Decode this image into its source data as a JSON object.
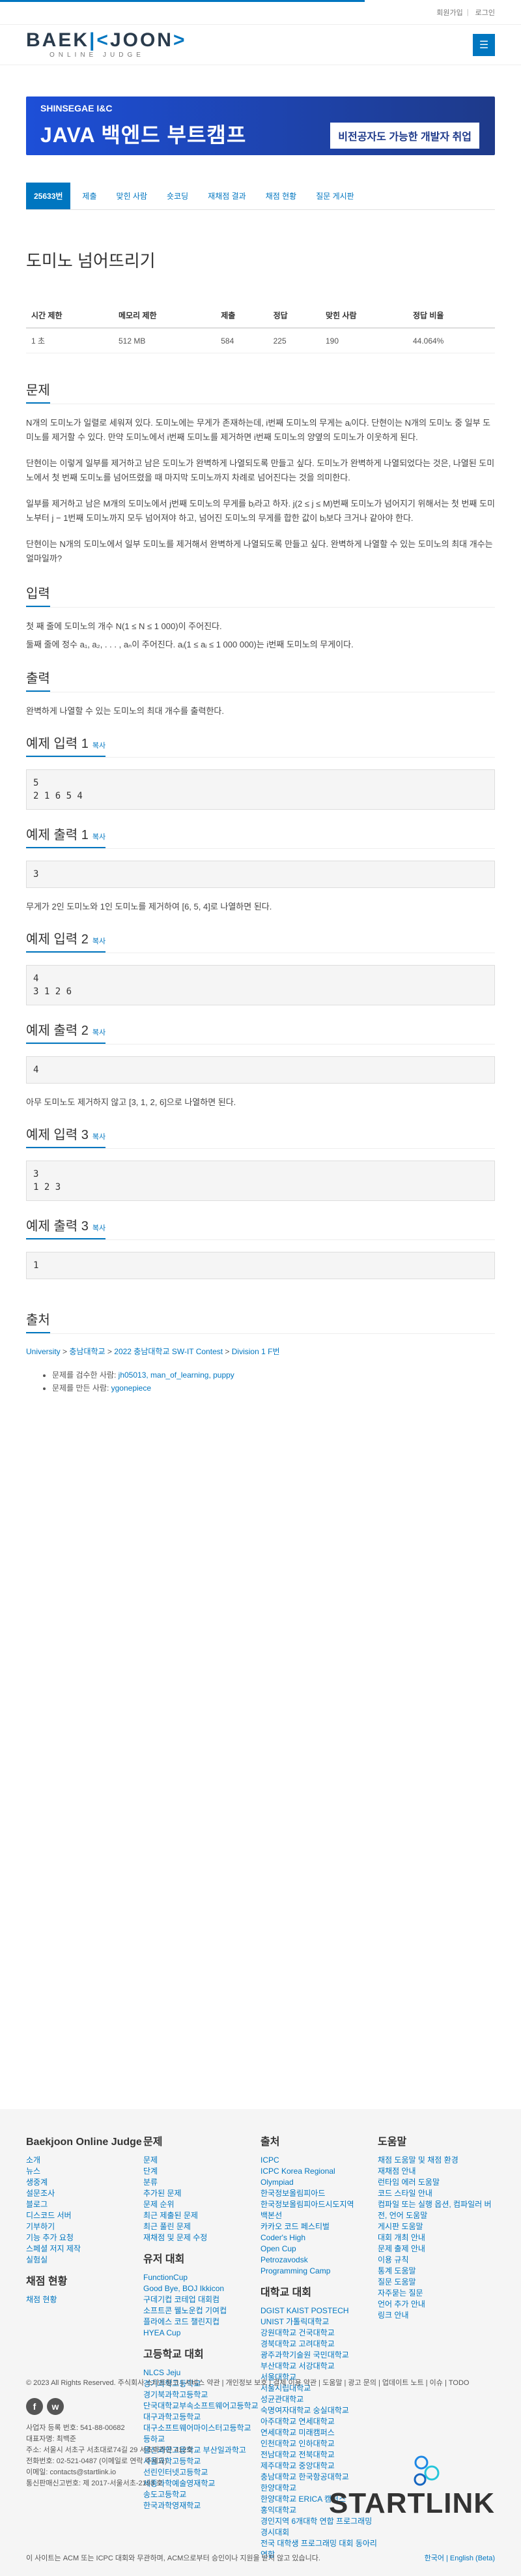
{
  "topbar": {
    "signup": "회원가입",
    "login": "로그인"
  },
  "logo": {
    "main_part1": "BAEK",
    "main_part2": "JOON",
    "sub": "ONLINE JUDGE"
  },
  "ad": {
    "top": "SHINSEGAE I&C",
    "left": "JAVA 백엔드 부트캠프",
    "right": "비전공자도 가능한 개발자 취업"
  },
  "tabs": [
    "25633번",
    "제출",
    "맞힌 사람",
    "숏코딩",
    "재채점 결과",
    "채점 현황",
    "질문 게시판"
  ],
  "problem": {
    "title": "도미노 넘어뜨리기",
    "table_headers": [
      "시간 제한",
      "메모리 제한",
      "제출",
      "정답",
      "맞힌 사람",
      "정답 비율"
    ],
    "table_values": [
      "1 초",
      "512 MB",
      "584",
      "225",
      "190",
      "44.064%"
    ]
  },
  "sections": {
    "problem": "문제",
    "input": "입력",
    "output": "출력",
    "source": "출처"
  },
  "description": [
    "N개의 도미노가 일렬로 세워져 있다. 도미노에는 무게가 존재하는데, i번째 도미노의 무게는 aᵢ이다. 단현이는 N개의 도미노 중 일부 도미노를 제거할 수 있다. 만약 도미노에서 i번째 도미노를 제거하면 i번째 도미노의 양옆의 도미노가 이웃하게 된다.",
    "단현이는 이렇게 일부를 제거하고 남은 도미노가 완벽하게 나열되도록 만들고 싶다. 도미노가 완벽하게 나열되었다는 것은, 나열된 도미노에서 첫 번째 도미노를 넘어뜨렸을 때 마지막 도미노까지 차례로 넘어진다는 것을 의미한다.",
    "일부를 제거하고 남은 M개의 도미노에서 j번째 도미노의 무게를 bⱼ라고 하자. j(2 ≤ j ≤ M)번째 도미노가 넘어지기 위해서는 첫 번째 도미노부터 j − 1번째 도미노까지 모두 넘어져야 하고, 넘어진 도미노의 무게를 합한 값이 bⱼ보다 크거나 같아야 한다.",
    "단현이는 N개의 도미노에서 일부 도미노를 제거해서 완벽하게 나열되도록 만들고 싶다. 완벽하게 나열할 수 있는 도미노의 최대 개수는 얼마일까?"
  ],
  "input_desc": [
    "첫 째 줄에 도미노의 개수 N(1 ≤ N ≤ 1 000)이 주어진다.",
    "둘째 줄에 정수 a₁, a₂, . . . , aₙ이 주어진다. aᵢ(1 ≤ aᵢ ≤ 1 000 000)는 i번째 도미노의 무게이다."
  ],
  "output_desc": "완벽하게 나열할 수 있는 도미노의 최대 개수를 출력한다.",
  "copy_label": "복사",
  "samples": [
    {
      "input_title": "예제 입력 1",
      "input": "5\n2 1 6 5 4",
      "output_title": "예제 출력 1",
      "output": "3",
      "explanation": "무게가 2인 도미노와 1인 도미노를 제거하여 [6, 5, 4]로 나열하면 된다."
    },
    {
      "input_title": "예제 입력 2",
      "input": "4\n3 1 2 6",
      "output_title": "예제 출력 2",
      "output": "4",
      "explanation": "아무 도미노도 제거하지 않고 [3, 1, 2, 6]으로 나열하면 된다."
    },
    {
      "input_title": "예제 입력 3",
      "input": "3\n1 2 3",
      "output_title": "예제 출력 3",
      "output": "1",
      "explanation": ""
    }
  ],
  "source": {
    "breadcrumb": [
      "University",
      "충남대학교",
      "2022 충남대학교 SW-IT Contest",
      "Division 1 F번"
    ],
    "breadcrumb_sep": " > ",
    "items": [
      {
        "label": "문제를 검수한 사람: ",
        "users": "jh05013, man_of_learning, puppy"
      },
      {
        "label": "문제를 만든 사람: ",
        "users": "ygonepiece"
      }
    ]
  },
  "footer": {
    "col1_title": "Baekjoon Online Judge",
    "col1": [
      "소개",
      "뉴스",
      "생중계",
      "설문조사",
      "블로그",
      "디스코드 서버",
      "기부하기",
      "기능 추가 요청",
      "스페셜 저지 제작",
      "실험실"
    ],
    "col1_title2": "채점 현황",
    "col1b": [
      "채점 현황"
    ],
    "col2_title": "문제",
    "col2": [
      "문제",
      "단계",
      "분류",
      "추가된 문제",
      "문제 순위",
      "최근 제출된 문제",
      "최근 풀린 문제",
      "재채점 및 문제 수정"
    ],
    "col2_title2": "유저 대회",
    "col2b": [
      "FunctionCup",
      "Good Bye, BOJ Ikkicon",
      "구데기컵 코테업 대회컴",
      "소프트콘 웰노운컵 기여컵",
      "플라에스 코드 챌린지컵",
      "HYEA Cup"
    ],
    "col2_title3": "고등학교 대회",
    "col2c": [
      "NLCS Jeju",
      "경기과학고등학교",
      "경기북과학고등학교",
      "단국대학교부속소프트웨어고등학교",
      "대구과학고등학교",
      "대구소프트웨어마이스터고등학교",
      "등하교",
      "울산과학고등학교 부산일과학고",
      "서울과학고등학교",
      "선린인터넷고등학교",
      "세종과학예술영재학교",
      "송도고등학교",
      "한국과학영재학교"
    ],
    "col3_title": "출처",
    "col3": [
      "ICPC",
      "ICPC Korea Regional",
      "Olympiad",
      "한국정보올림피아드",
      "한국정보올림피아드시도지역",
      "백본선",
      "카카오 코드 페스티벌",
      "Coder's High",
      "Open Cup",
      "Petrozavodsk",
      "Programming Camp"
    ],
    "col3_title2": "대학교 대회",
    "col3b": [
      "DGIST KAIST POSTECH",
      "UNIST 가톨릭대학교",
      "강원대학교 건국대학교",
      "경북대학교 고려대학교",
      "광주과학기술원 국민대학교",
      "부산대학교 서강대학교",
      "서울대학교",
      "서울시립대학교",
      "성균관대학교",
      "숙명여자대학교 숭실대학교",
      "아주대학교 연세대학교",
      "연세대학교 미래캠퍼스",
      "인천대학교 인하대학교",
      "전남대학교 전북대학교",
      "제주대학교 중앙대학교",
      "충남대학교 한국항공대학교",
      "한양대학교",
      "한양대학교 ERICA 캠퍼스",
      "홍익대학교",
      "경인지역 6개대학 연합 프로그래밍 경시대회",
      "전국 대학생 프로그래밍 대회 동아리 연합"
    ],
    "col4_title": "도움말",
    "col4": [
      "채점 도움말 및 채점 환경",
      "재채점 안내",
      "런타임 에러 도움말",
      "코드 스타일 안내",
      "컴파일 또는 실행 옵션, 컴파일러 버전, 언어 도움말",
      "게시판 도움말",
      "대회 개최 안내",
      "문제 출제 안내",
      "이용 규칙",
      "통계 도움말",
      "질문 도움말",
      "자주묻는 질문",
      "언어 추가 안내",
      "링크 안내"
    ],
    "copyright": "© 2023 All Rights Reserved. 주식회사 스타트링크",
    "links": " | 서비스 약관 | 개인정보 보호 | 결제 이용 약관 | 도움말 | 광고 문의 | 업데이트 노트 | 이슈 | TODO",
    "social": [
      "f",
      "w"
    ],
    "company": [
      "사업자 등록 번호: 541-88-00682",
      "대표자명: 최백준",
      "주소: 서울시 서초구 서초대로74길 29 서초파라곤 412호",
      "전화번호: 02-521-0487 (이메일로 연락 주세요)",
      "이메일: contacts@startlink.io",
      "통신판매신고번호: 제 2017-서울서초-2193 호"
    ],
    "logo": "STARTLINK",
    "note": "이 사이트는 ACM 또는 ICPC 대회와 무관하며, ACM으로부터 승인이나 지원을 받지 않고 있습니다.",
    "lang": "한국어 | English (Beta)"
  }
}
